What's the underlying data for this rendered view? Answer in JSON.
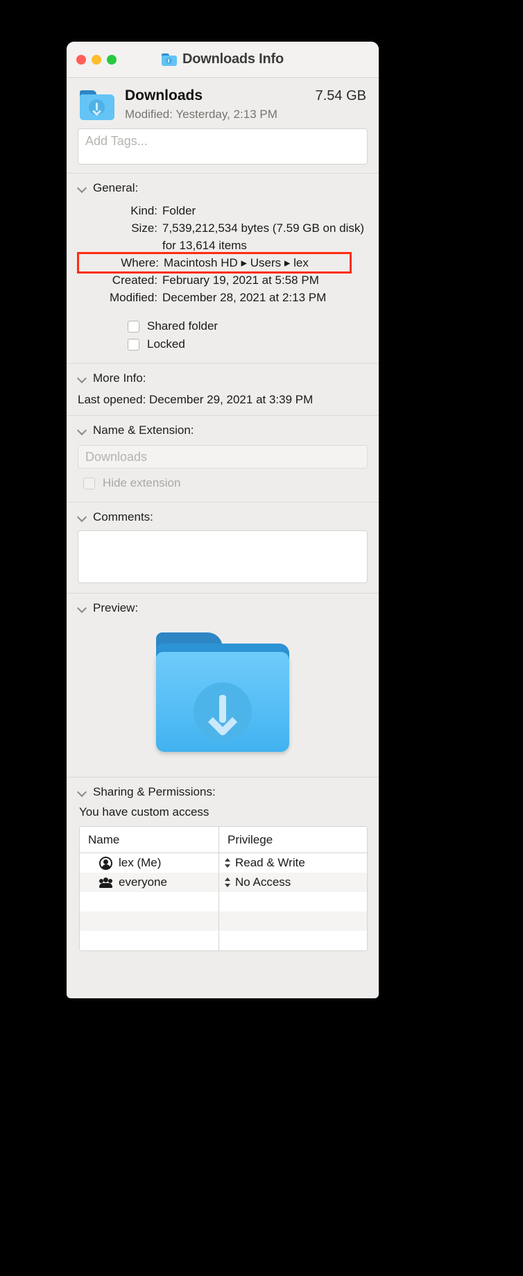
{
  "window": {
    "title": "Downloads Info",
    "traffic_lights": [
      "close",
      "minimize",
      "zoom"
    ]
  },
  "header": {
    "name": "Downloads",
    "size": "7.54 GB",
    "modified_label": "Modified:",
    "modified_value": "Yesterday, 2:13 PM"
  },
  "tags": {
    "placeholder": "Add Tags..."
  },
  "general": {
    "title": "General:",
    "rows": [
      {
        "key": "Kind:",
        "value": "Folder"
      },
      {
        "key": "Size:",
        "value": "7,539,212,534 bytes (7.59 GB on disk) for 13,614 items"
      },
      {
        "key": "Where:",
        "value": "Macintosh HD ▸ Users ▸ lex",
        "highlighted": true
      },
      {
        "key": "Created:",
        "value": "February 19, 2021 at 5:58 PM"
      },
      {
        "key": "Modified:",
        "value": "December 28, 2021 at 2:13 PM"
      }
    ],
    "checkboxes": [
      {
        "label": "Shared folder",
        "checked": false,
        "enabled": true
      },
      {
        "label": "Locked",
        "checked": false,
        "enabled": true
      }
    ]
  },
  "more_info": {
    "title": "More Info:",
    "last_opened": "Last opened: December 29, 2021 at 3:39 PM"
  },
  "name_extension": {
    "title": "Name & Extension:",
    "field_value": "Downloads",
    "hide_extension_label": "Hide extension",
    "hide_extension_checked": false
  },
  "comments": {
    "title": "Comments:",
    "value": ""
  },
  "preview": {
    "title": "Preview:",
    "icon": "downloads-folder-icon"
  },
  "sharing": {
    "title": "Sharing & Permissions:",
    "access_note": "You have custom access",
    "columns": [
      "Name",
      "Privilege"
    ],
    "rows": [
      {
        "icon": "user-icon",
        "name": "lex (Me)",
        "privilege": "Read & Write"
      },
      {
        "icon": "group-icon",
        "name": "everyone",
        "privilege": "No Access"
      }
    ]
  },
  "colors": {
    "highlight": "#ff2d12",
    "folder_body": "#63c4f5",
    "folder_tab": "#2d86c4",
    "window_bg": "#eeedeb"
  }
}
